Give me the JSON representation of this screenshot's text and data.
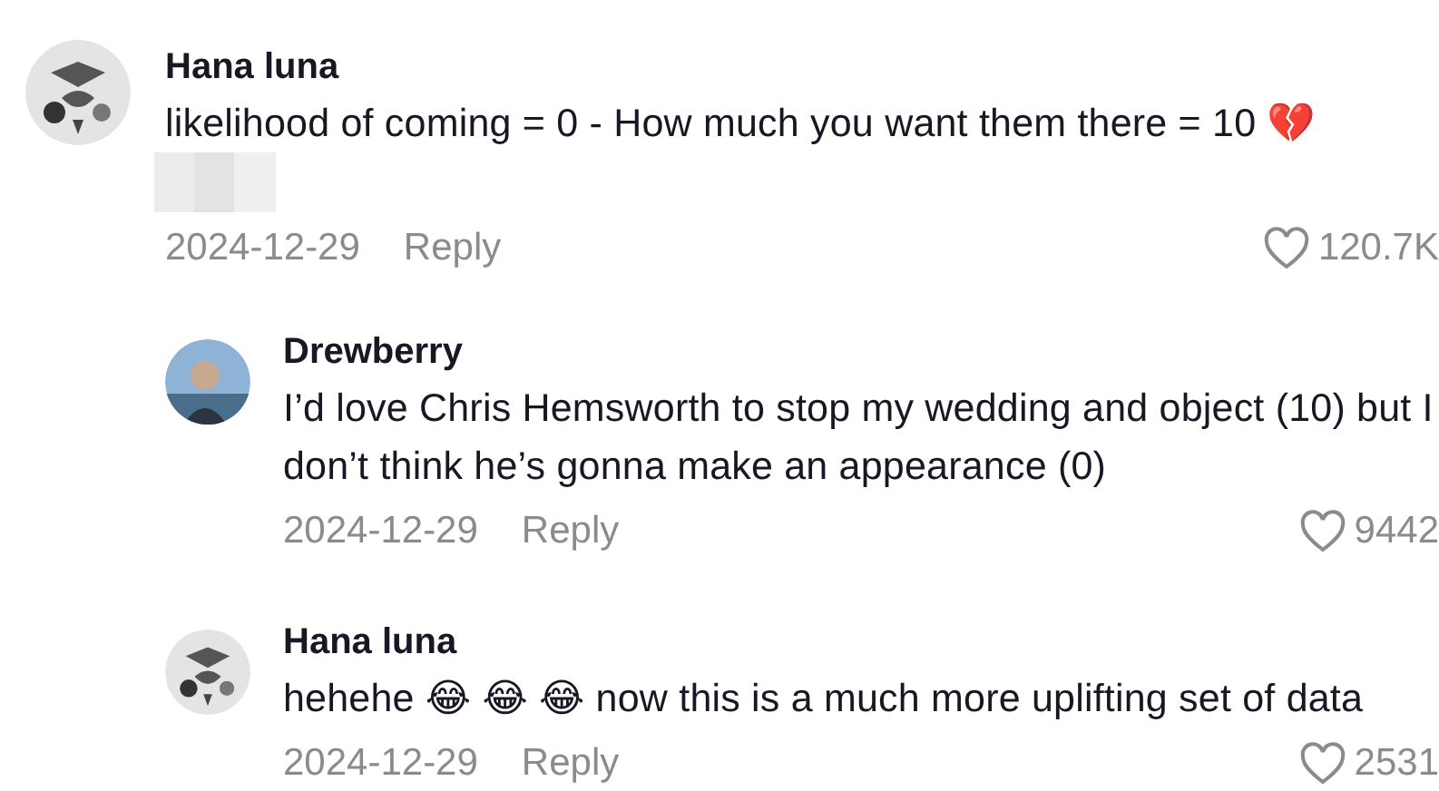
{
  "comments": [
    {
      "author": "Hana luna",
      "text": "likelihood of coming = 0 - How much you want them there = 10 💔",
      "has_image": true,
      "date": "2024-12-29",
      "reply_label": "Reply",
      "likes": "120.7K",
      "kind": "sketch",
      "replies": [
        {
          "author": "Drewberry",
          "text": "I’d love Chris Hemsworth to stop my wedding and object (10) but I don’t think he’s gonna make an appearance (0)",
          "has_image": false,
          "date": "2024-12-29",
          "reply_label": "Reply",
          "likes": "9442",
          "kind": "photo"
        },
        {
          "author": "Hana luna",
          "text": "hehehe 😂 😂 😂 now this is a much more uplifting set of data",
          "has_image": false,
          "date": "2024-12-29",
          "reply_label": "Reply",
          "likes": "2531",
          "kind": "sketch"
        }
      ]
    }
  ]
}
